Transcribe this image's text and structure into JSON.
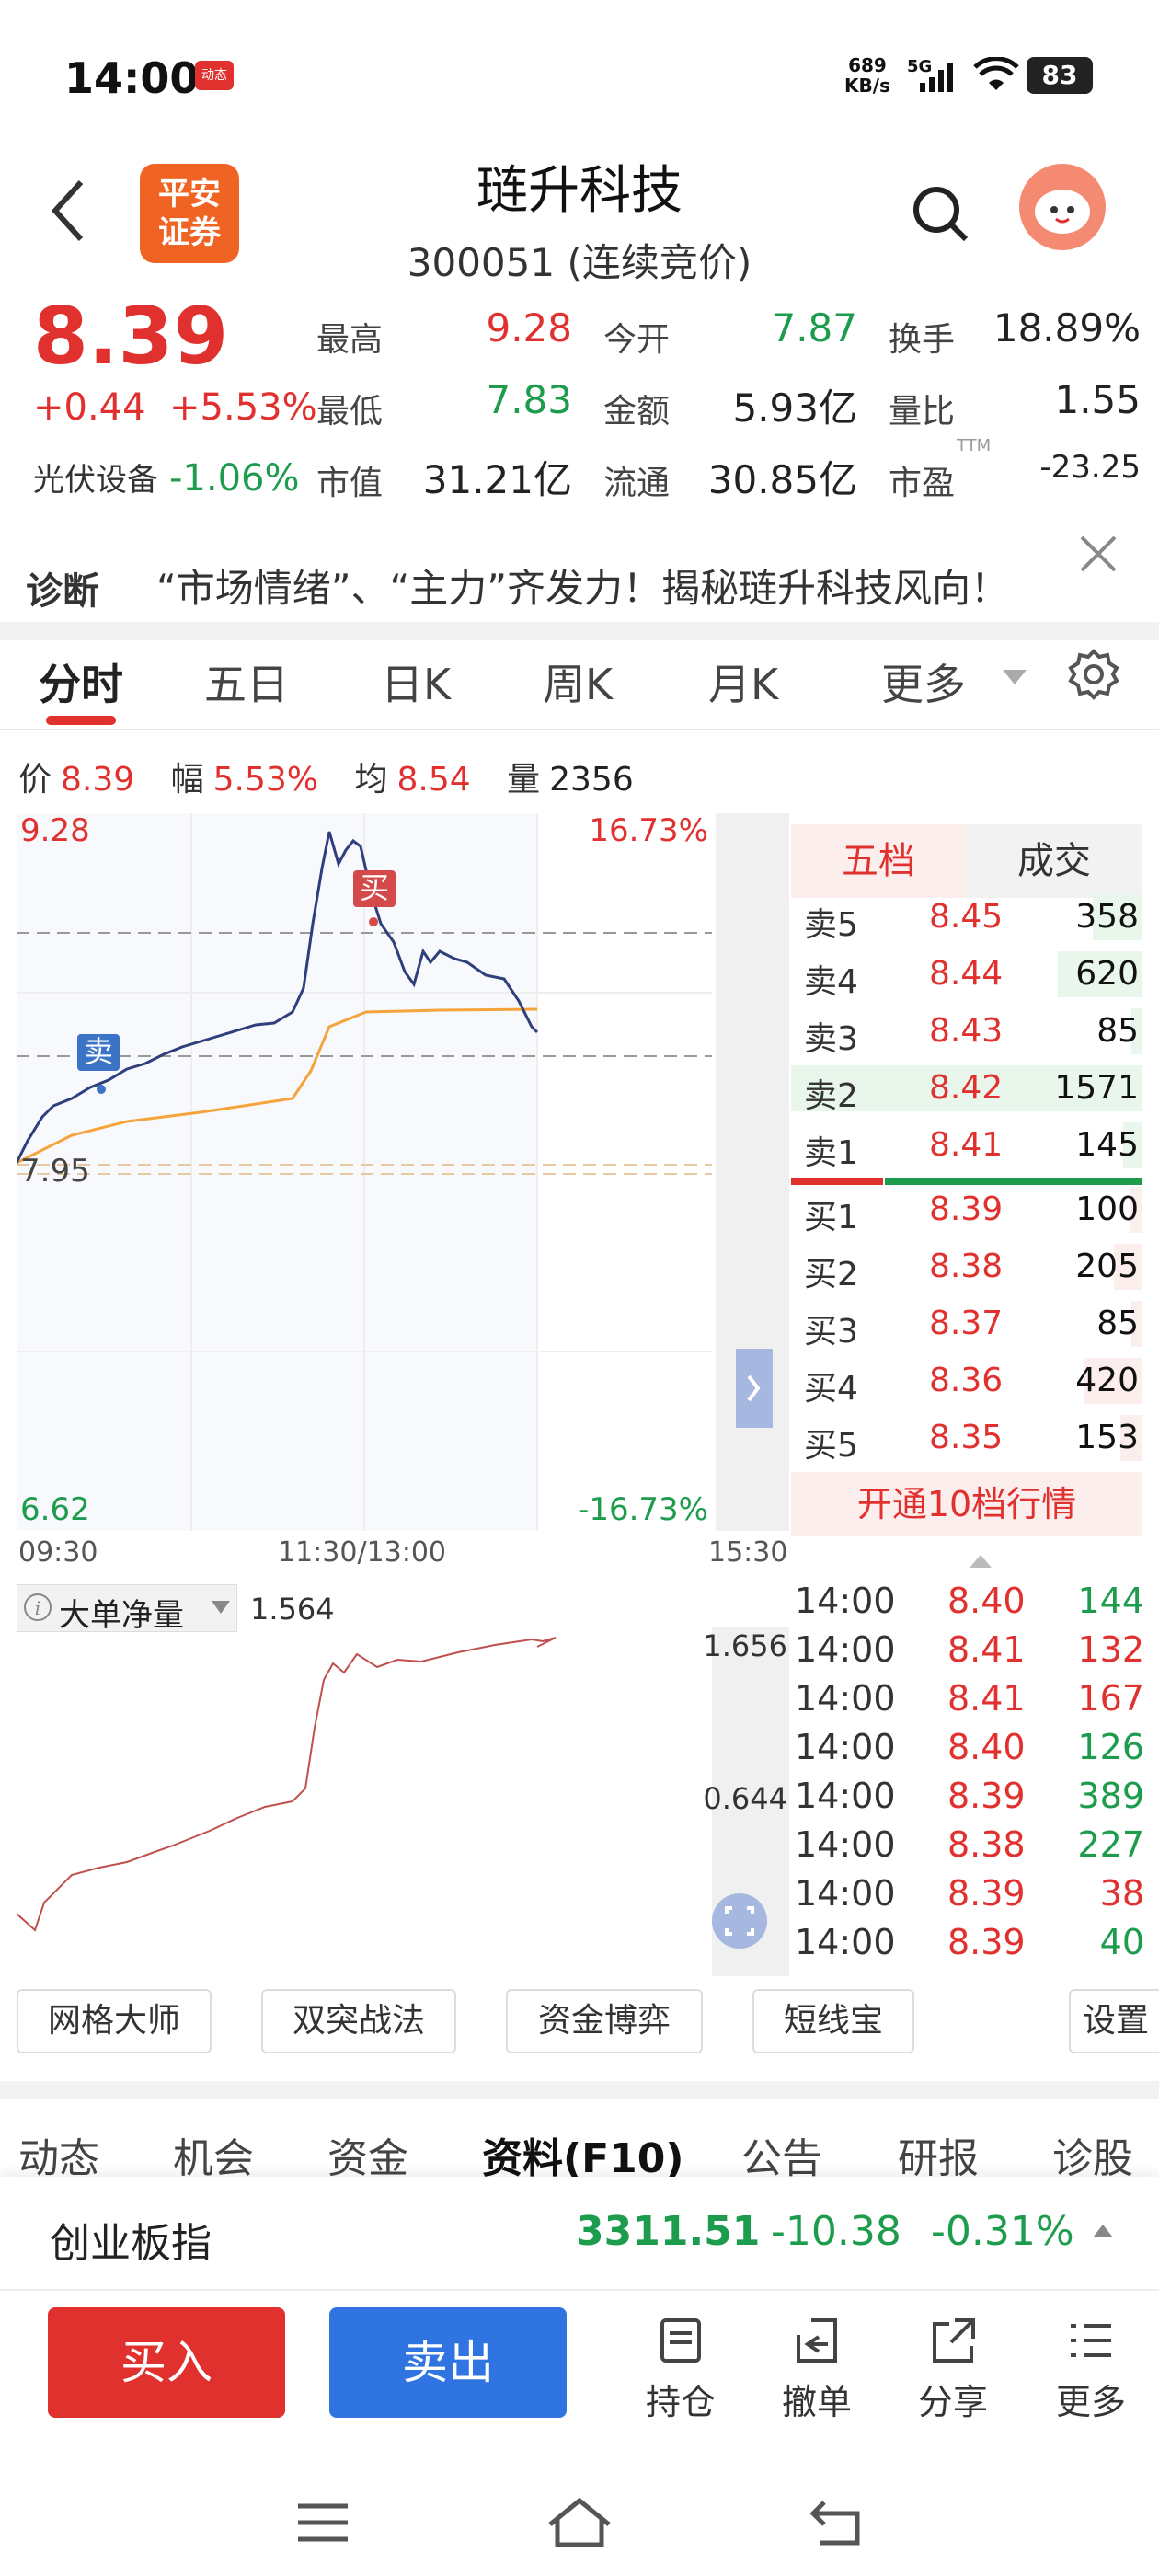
{
  "status": {
    "time": "14:00",
    "badge": "动态",
    "net_speed_top": "689",
    "net_speed_bottom": "KB/s",
    "signal": "5G",
    "battery": "83"
  },
  "header": {
    "logo_line1": "平安",
    "logo_line2": "证券",
    "title": "琏升科技",
    "subtitle": "300051 (连续竞价)"
  },
  "quote": {
    "price": "8.39",
    "change": "+0.44",
    "change_pct": "+5.53%",
    "sector_name": "光伏设备",
    "sector_chg": "-1.06%",
    "fields": [
      {
        "label": "最高",
        "value": "9.28",
        "color": "#e0312f"
      },
      {
        "label": "今开",
        "value": "7.87",
        "color": "#1e9c4e"
      },
      {
        "label": "换手",
        "value": "18.89%",
        "color": "#222222"
      },
      {
        "label": "最低",
        "value": "7.83",
        "color": "#1e9c4e"
      },
      {
        "label": "金额",
        "value": "5.93亿",
        "color": "#222222"
      },
      {
        "label": "量比",
        "value": "1.55",
        "color": "#222222"
      },
      {
        "label": "市值",
        "value": "31.21亿",
        "color": "#222222"
      },
      {
        "label": "流通",
        "value": "30.85亿",
        "color": "#222222"
      },
      {
        "label": "市盈",
        "value": "-23.25",
        "color": "#222222",
        "sup": "TTM"
      }
    ]
  },
  "diagnosis": {
    "label": "诊断",
    "text": "“市场情绪”、“主力”齐发力！揭秘琏升科技风向！"
  },
  "tabs": [
    "分时",
    "五日",
    "日K",
    "周K",
    "月K",
    "更多"
  ],
  "info": {
    "price_label": "价",
    "price": "8.39",
    "amp_label": "幅",
    "amp": "5.53%",
    "avg_label": "均",
    "avg": "8.54",
    "vol_label": "量",
    "vol": "2356"
  },
  "chart_data": {
    "type": "line",
    "series": [],
    "x_range": [
      "09:30",
      "15:30"
    ],
    "ylim": [
      6.62,
      9.28
    ],
    "y_top_label": "9.28",
    "y_bottom_label": "6.62",
    "y_ref_label": "7.95",
    "pct_top_label": "16.73%",
    "pct_bottom_label": "-16.73%",
    "time_labels": [
      "09:30",
      "11:30/13:00",
      "15:30"
    ],
    "markers": [
      {
        "label": "卖"
      },
      {
        "label": "买"
      }
    ],
    "grid": true
  },
  "chart_data_flow": {
    "type": "line",
    "title": "大单净量",
    "current": "1.564",
    "y_labels": [
      "1.656",
      "0.644"
    ]
  },
  "orderbook": {
    "tab_active": "五档",
    "tab_other": "成交",
    "asks": [
      {
        "label": "卖5",
        "price": "8.45",
        "vol": "358",
        "frac": 0.23
      },
      {
        "label": "卖4",
        "price": "8.44",
        "vol": "620",
        "frac": 0.39
      },
      {
        "label": "卖3",
        "price": "8.43",
        "vol": "85",
        "frac": 0.05
      },
      {
        "label": "卖2",
        "price": "8.42",
        "vol": "1571",
        "frac": 1.0
      },
      {
        "label": "卖1",
        "price": "8.41",
        "vol": "145",
        "frac": 0.09
      }
    ],
    "bids": [
      {
        "label": "买1",
        "price": "8.39",
        "vol": "100",
        "frac": 0.06
      },
      {
        "label": "买2",
        "price": "8.38",
        "vol": "205",
        "frac": 0.13
      },
      {
        "label": "买3",
        "price": "8.37",
        "vol": "85",
        "frac": 0.05
      },
      {
        "label": "买4",
        "price": "8.36",
        "vol": "420",
        "frac": 0.27
      },
      {
        "label": "买5",
        "price": "8.35",
        "vol": "153",
        "frac": 0.1
      }
    ],
    "open10": "开通10档行情"
  },
  "ticks": [
    {
      "time": "14:00",
      "price": "8.40",
      "vol": "144",
      "pc": "#e0312f",
      "vc": "#1e9c4e"
    },
    {
      "time": "14:00",
      "price": "8.41",
      "vol": "132",
      "pc": "#e0312f",
      "vc": "#e0312f"
    },
    {
      "time": "14:00",
      "price": "8.41",
      "vol": "167",
      "pc": "#e0312f",
      "vc": "#e0312f"
    },
    {
      "time": "14:00",
      "price": "8.40",
      "vol": "126",
      "pc": "#e0312f",
      "vc": "#1e9c4e"
    },
    {
      "time": "14:00",
      "price": "8.39",
      "vol": "389",
      "pc": "#e0312f",
      "vc": "#1e9c4e"
    },
    {
      "time": "14:00",
      "price": "8.38",
      "vol": "227",
      "pc": "#e0312f",
      "vc": "#1e9c4e"
    },
    {
      "time": "14:00",
      "price": "8.39",
      "vol": "38",
      "pc": "#e0312f",
      "vc": "#e0312f"
    },
    {
      "time": "14:00",
      "price": "8.39",
      "vol": "40",
      "pc": "#e0312f",
      "vc": "#1e9c4e"
    }
  ],
  "tools": [
    "网格大师",
    "双突战法",
    "资金博弈",
    "短线宝",
    "设置"
  ],
  "categories": [
    "动态",
    "机会",
    "资金",
    "资料(F10)",
    "公告",
    "研报",
    "诊股"
  ],
  "index": {
    "name": "创业板指",
    "value": "3311.51",
    "change": "-10.38",
    "pct": "-0.31%"
  },
  "actions": {
    "buy": "买入",
    "sell": "卖出",
    "hold": "持仓",
    "cancel": "撤单",
    "share": "分享",
    "more": "更多"
  },
  "colors": {
    "up": "#e0312f",
    "down": "#1e9c4e",
    "accent_orange": "#f06423",
    "sell_blue": "#2f74e0"
  }
}
